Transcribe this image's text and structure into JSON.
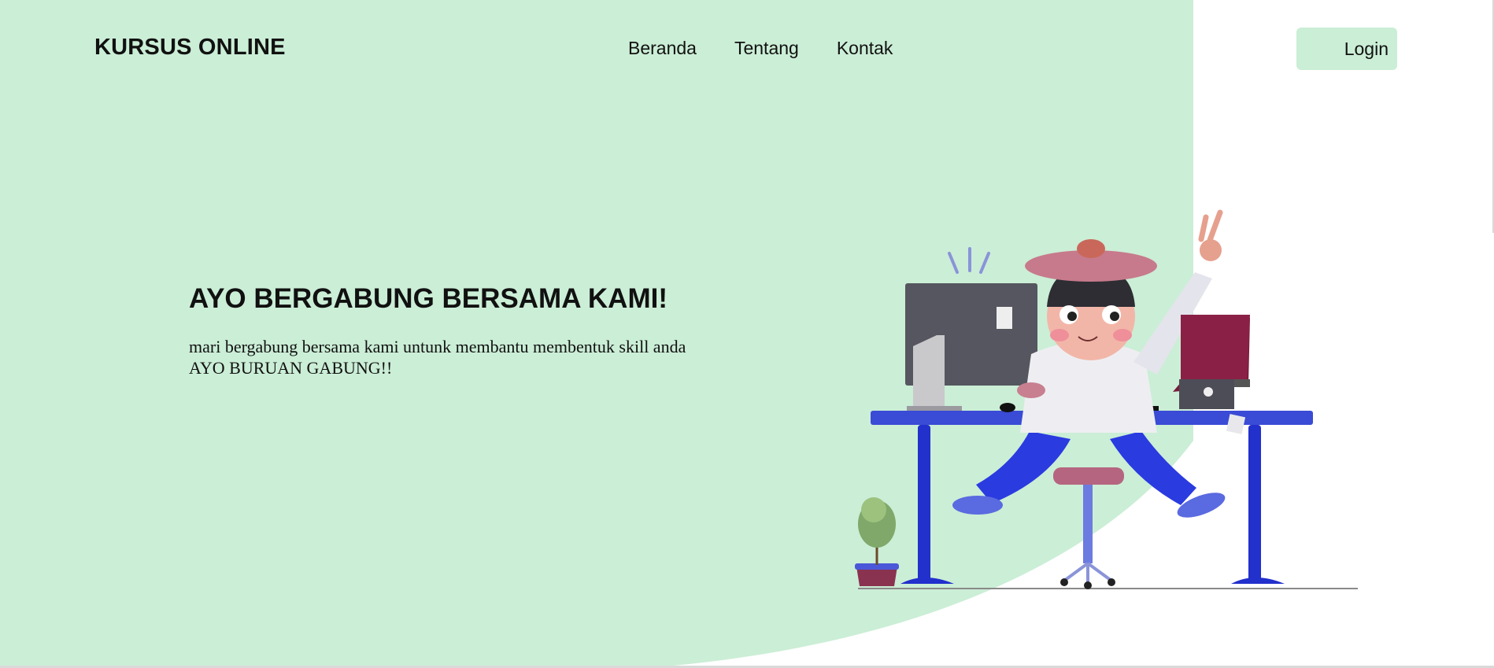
{
  "navbar": {
    "brand": "KURSUS ONLINE",
    "links": [
      {
        "label": "Beranda"
      },
      {
        "label": "Tentang"
      },
      {
        "label": "Kontak"
      }
    ],
    "login_label": "Login"
  },
  "hero": {
    "title": "AYO BERGABUNG BERSAMA KAMI!",
    "subtitle_line1": "mari bergabung bersama kami untunk membantu membentuk skill anda",
    "subtitle_line2": "AYO BURUAN GABUNG!!"
  },
  "colors": {
    "accent_green": "#cbeed6",
    "desk_blue": "#3a4bd6",
    "text": "#111111"
  },
  "icons": {
    "illustration": "person-at-desk-illustration"
  }
}
